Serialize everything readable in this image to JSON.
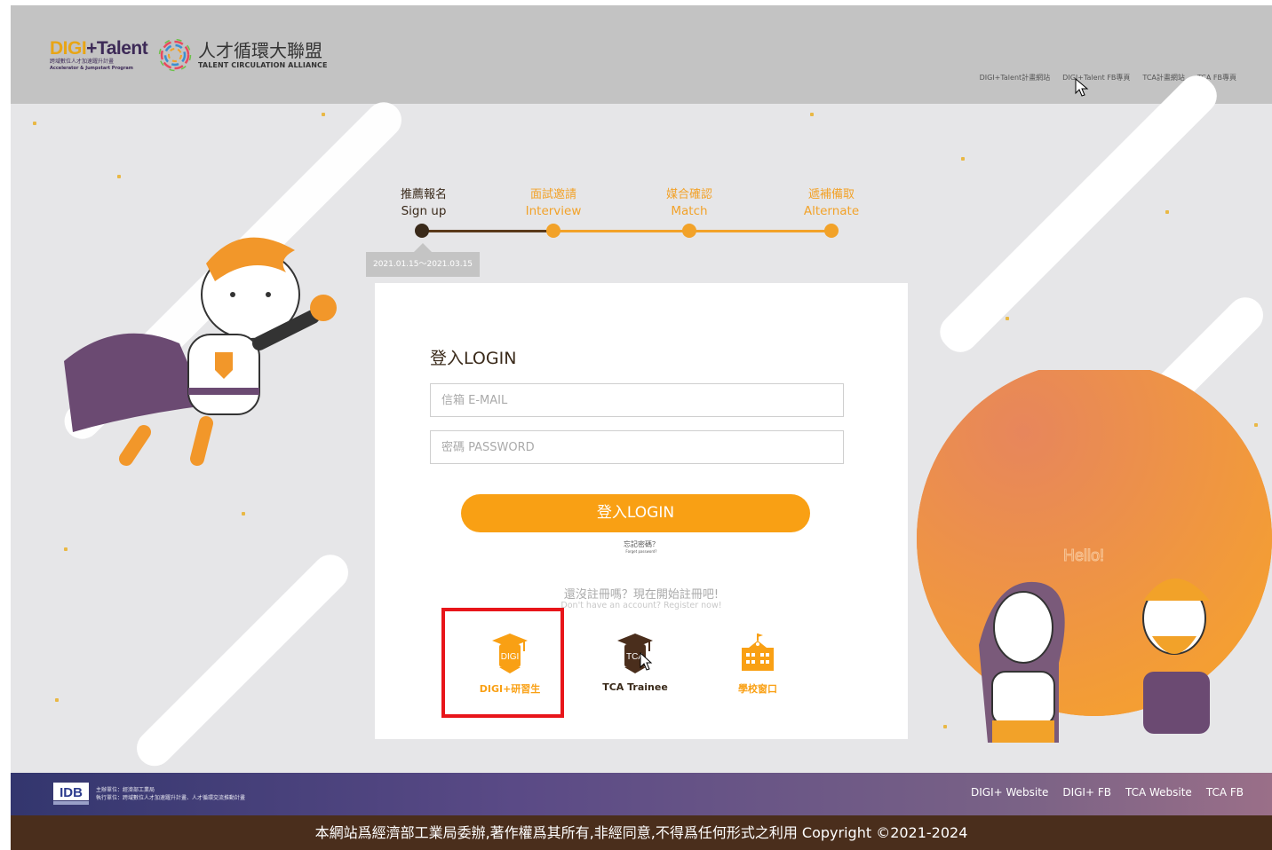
{
  "header": {
    "digi_logo": {
      "name_prefix": "DIGI",
      "name_suffix": "+Talent",
      "sub_zh": "跨域數位人才加速躍升計畫",
      "sub_en": "Accelerator & Jumpstart Program"
    },
    "tca_logo": {
      "title": "人才循環大聯盟",
      "subtitle": "TALENT CIRCULATION ALLIANCE"
    },
    "nav": [
      "DIGI+Talent計畫網站",
      "DIGI+Talent FB專頁",
      "TCA計畫網站",
      "TCA FB專頁"
    ]
  },
  "progress": {
    "steps": [
      {
        "zh": "推薦報名",
        "en": "Sign up"
      },
      {
        "zh": "面試邀請",
        "en": "Interview"
      },
      {
        "zh": "媒合確認",
        "en": "Match"
      },
      {
        "zh": "遞補備取",
        "en": "Alternate"
      }
    ],
    "date_range": "2021.01.15～2021.03.15"
  },
  "login": {
    "title": "登入LOGIN",
    "email_placeholder": "信箱 E-MAIL",
    "password_placeholder": "密碼 PASSWORD",
    "button": "登入LOGIN",
    "forgot_zh": "忘記密碼？",
    "forgot_en": "Forget password?",
    "register_zh": "還沒註冊嗎？現在開始註冊吧!",
    "register_en": "Don't have an account? Register now!",
    "roles": [
      {
        "label": "DIGI+研習生",
        "icon_text": "DIGI",
        "icon": "graduation-cap-icon",
        "color": "#f9a014"
      },
      {
        "label": "TCA Trainee",
        "icon_text": "TCA",
        "icon": "graduation-cap-icon",
        "color": "#4a2e1c"
      },
      {
        "label": "學校窗口",
        "icon_text": "",
        "icon": "school-icon",
        "color": "#f9a014"
      }
    ]
  },
  "scene": {
    "hello_bubble": "Hello!"
  },
  "footer": {
    "organizer_line1": "主辦單位：經濟部工業局",
    "organizer_line2": "執行單位：跨域數位人才加速躍升計畫、人才循環交流推動計畫",
    "links": [
      "DIGI+ Website",
      "DIGI+ FB",
      "TCA Website",
      "TCA FB"
    ],
    "copyright": "本網站爲經濟部工業局委辦,著作權爲其所有,非經同意,不得爲任何形式之利用 Copyright ©2021-2024"
  },
  "colors": {
    "accent": "#f9a014",
    "brown": "#4a2e1c",
    "highlight": "#e8151a"
  }
}
